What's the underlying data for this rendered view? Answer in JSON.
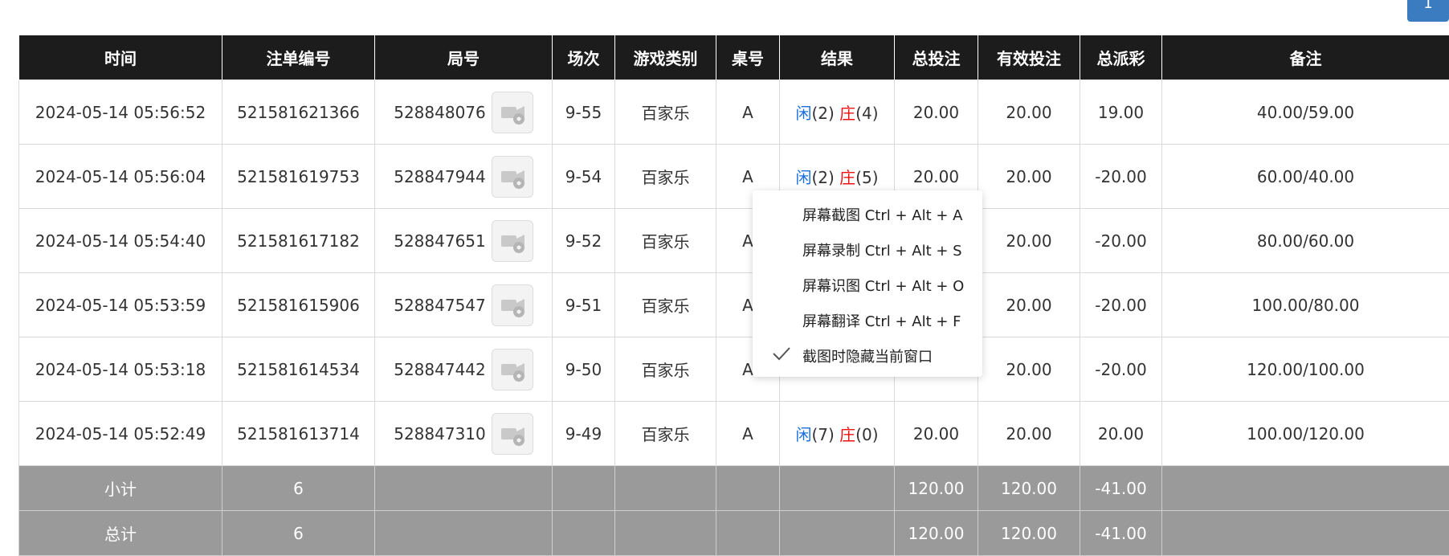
{
  "top_button": {
    "label": "1"
  },
  "table": {
    "headers": [
      "时间",
      "注单编号",
      "局号",
      "场次",
      "游戏类别",
      "桌号",
      "结果",
      "总投注",
      "有效投注",
      "总派彩",
      "备注"
    ],
    "rows": [
      {
        "time": "2024-05-14 05:56:52",
        "bet_id": "521581621366",
        "round_id": "528848076",
        "session": "9-55",
        "game": "百家乐",
        "table_no": "A",
        "player_label": "闲",
        "player_val": "(2)",
        "banker_label": "庄",
        "banker_val": "(4)",
        "total_bet": "20.00",
        "valid_bet": "20.00",
        "payout": "19.00",
        "payout_negative": false,
        "remark": "40.00/59.00"
      },
      {
        "time": "2024-05-14 05:56:04",
        "bet_id": "521581619753",
        "round_id": "528847944",
        "session": "9-54",
        "game": "百家乐",
        "table_no": "A",
        "player_label": "闲",
        "player_val": "(2)",
        "banker_label": "庄",
        "banker_val": "(5)",
        "total_bet": "20.00",
        "valid_bet": "20.00",
        "payout": "-20.00",
        "payout_negative": true,
        "remark": "60.00/40.00"
      },
      {
        "time": "2024-05-14 05:54:40",
        "bet_id": "521581617182",
        "round_id": "528847651",
        "session": "9-52",
        "game": "百家乐",
        "table_no": "A",
        "player_label": "",
        "player_val": "",
        "banker_label": "",
        "banker_val": "",
        "total_bet": "",
        "valid_bet": "20.00",
        "payout": "-20.00",
        "payout_negative": true,
        "remark": "80.00/60.00"
      },
      {
        "time": "2024-05-14 05:53:59",
        "bet_id": "521581615906",
        "round_id": "528847547",
        "session": "9-51",
        "game": "百家乐",
        "table_no": "A",
        "player_label": "",
        "player_val": "",
        "banker_label": "",
        "banker_val": "",
        "total_bet": "",
        "valid_bet": "20.00",
        "payout": "-20.00",
        "payout_negative": true,
        "remark": "100.00/80.00"
      },
      {
        "time": "2024-05-14 05:53:18",
        "bet_id": "521581614534",
        "round_id": "528847442",
        "session": "9-50",
        "game": "百家乐",
        "table_no": "A",
        "player_label": "",
        "player_val": "",
        "banker_label": "",
        "banker_val": "",
        "total_bet": "",
        "valid_bet": "20.00",
        "payout": "-20.00",
        "payout_negative": true,
        "remark": "120.00/100.00"
      },
      {
        "time": "2024-05-14 05:52:49",
        "bet_id": "521581613714",
        "round_id": "528847310",
        "session": "9-49",
        "game": "百家乐",
        "table_no": "A",
        "player_label": "闲",
        "player_val": "(7)",
        "banker_label": "庄",
        "banker_val": "(0)",
        "total_bet": "20.00",
        "valid_bet": "20.00",
        "payout": "20.00",
        "payout_negative": false,
        "remark": "100.00/120.00"
      }
    ],
    "subtotal": {
      "label": "小计",
      "count": "6",
      "total_bet": "120.00",
      "valid_bet": "120.00",
      "payout": "-41.00"
    },
    "total": {
      "label": "总计",
      "count": "6",
      "total_bet": "120.00",
      "valid_bet": "120.00",
      "payout": "-41.00"
    }
  },
  "context_menu": {
    "items": [
      "屏幕截图 Ctrl + Alt + A",
      "屏幕录制 Ctrl + Alt + S",
      "屏幕识图 Ctrl + Alt + O",
      "屏幕翻译 Ctrl + Alt + F",
      "截图时隐藏当前窗口"
    ],
    "checked_item": "截图时隐藏当前窗口"
  },
  "colors": {
    "header_bg": "#1c1c1c",
    "summary_bg": "#9a9a9a",
    "blue": "#1a6fe0",
    "red": "#ee1111"
  },
  "icons": {
    "video": "video-camera-icon",
    "check": "check-icon"
  }
}
